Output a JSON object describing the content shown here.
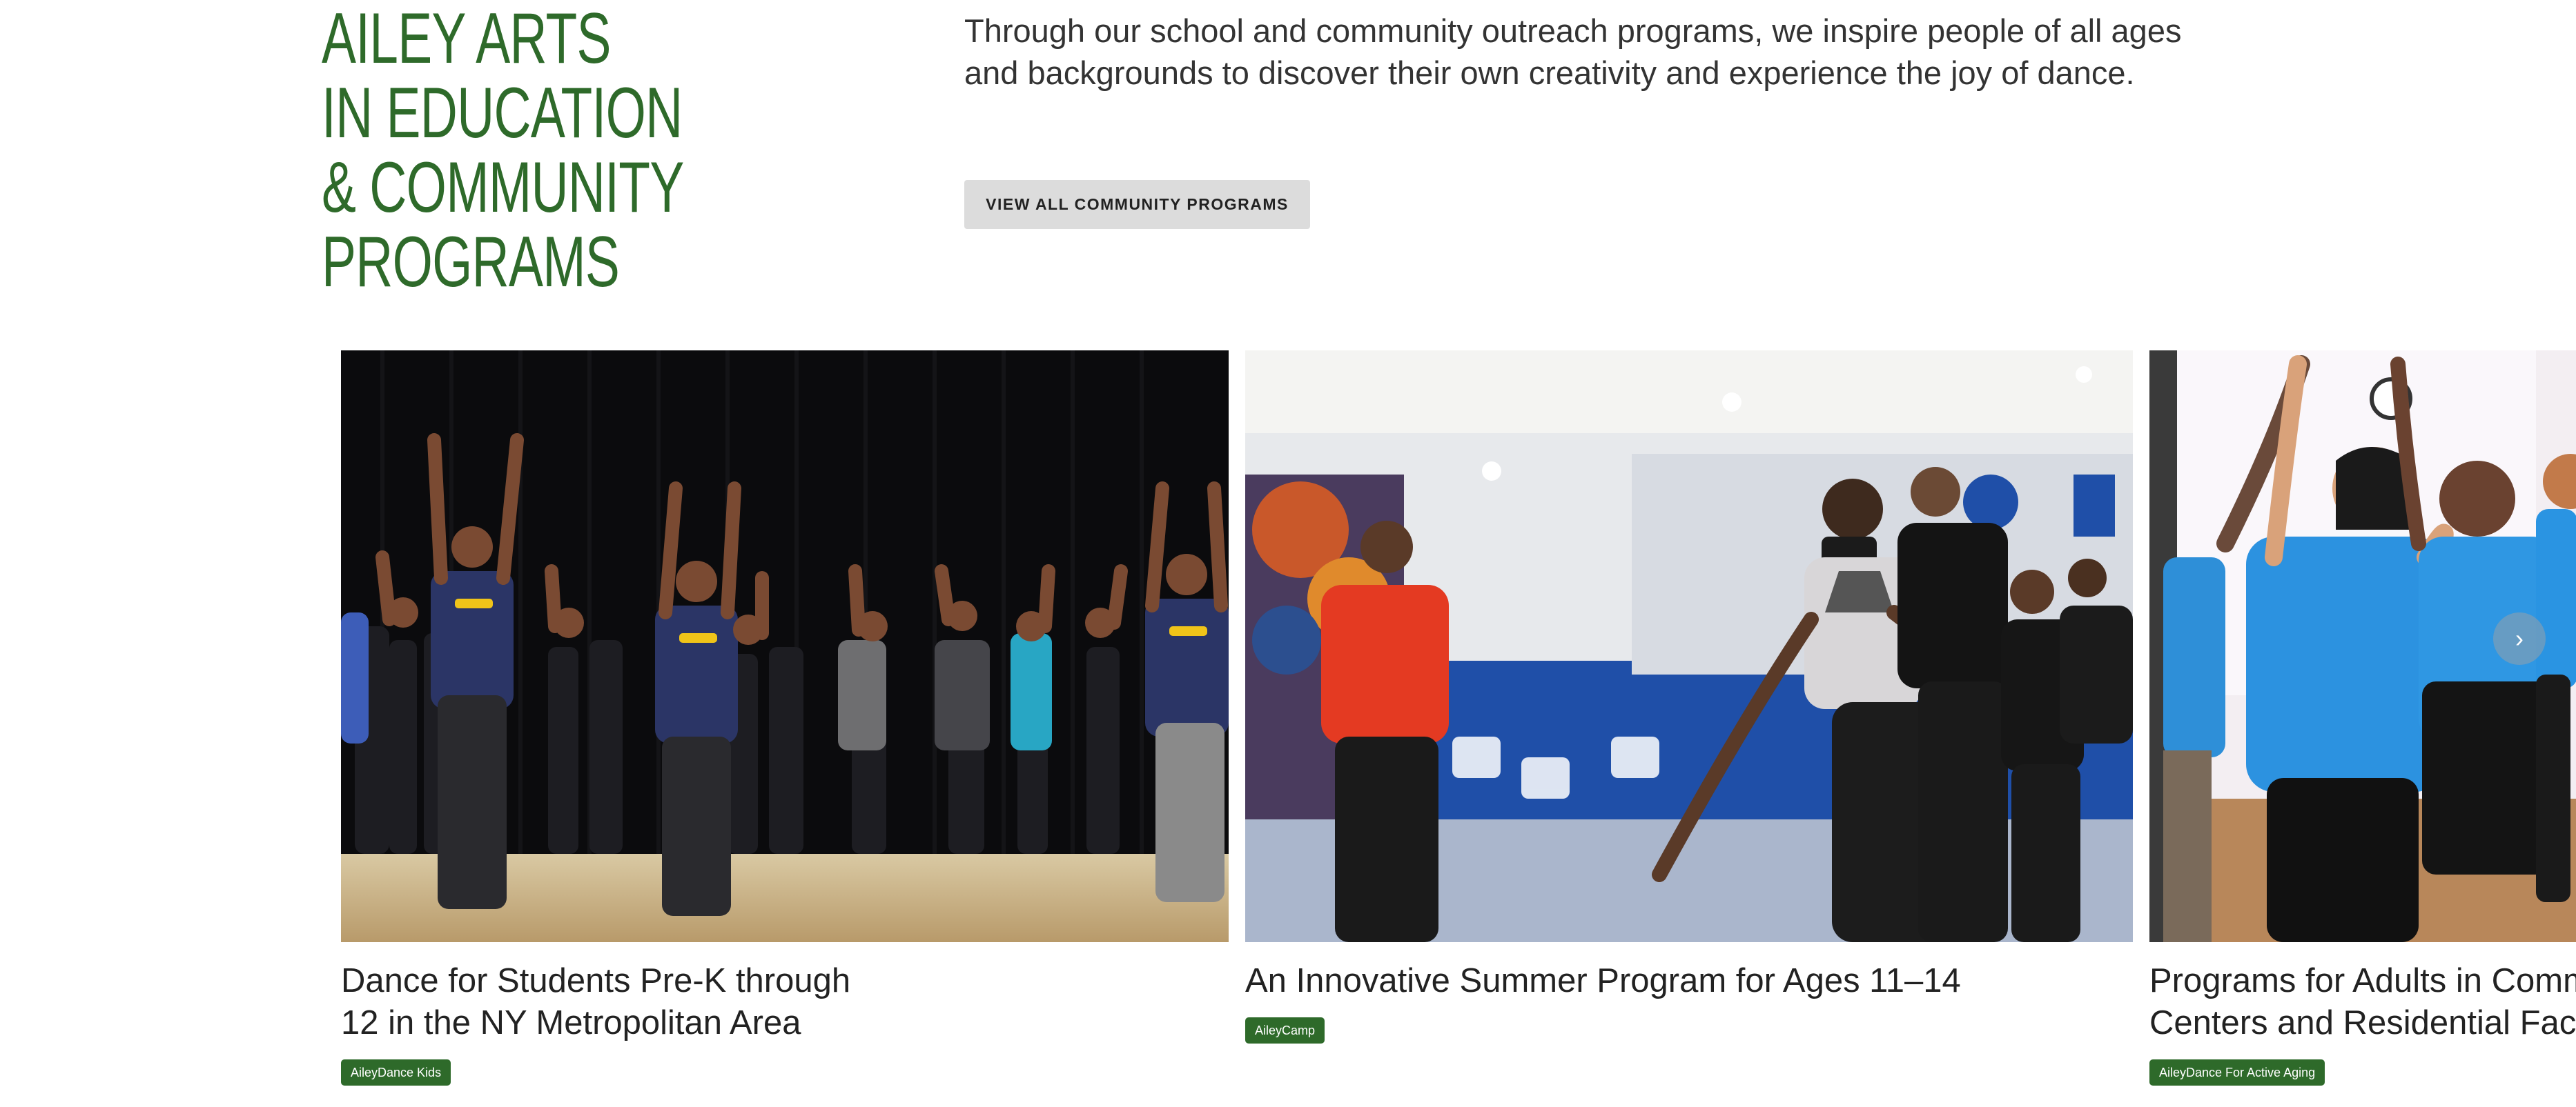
{
  "section": {
    "heading_lines": [
      "AILEY ARTS",
      "IN EDUCATION",
      "& COMMUNITY",
      "PROGRAMS"
    ],
    "intro_lines": [
      "Through our school and community outreach programs, we inspire people of all ages",
      "and backgrounds to discover their own creativity and experience the joy of dance."
    ],
    "cta_label": "VIEW ALL COMMUNITY PROGRAMS"
  },
  "cards": [
    {
      "title_lines": [
        "Dance for Students Pre-K through",
        "12 in the NY Metropolitan Area"
      ],
      "tag": "AileyDance Kids"
    },
    {
      "title_lines": [
        "An Innovative Summer Program for Ages 11–14"
      ],
      "tag": "AileyCamp"
    },
    {
      "title_lines": [
        "Programs for Adults in Comm",
        "Centers and Residential Facil"
      ],
      "tag": "AileyDance For Active Aging"
    }
  ],
  "carousel": {
    "next_icon": "chevron-right-icon",
    "next_glyph": "›"
  },
  "colors": {
    "brand_green": "#2e6a2a",
    "button_gray": "#dcdcdc"
  }
}
